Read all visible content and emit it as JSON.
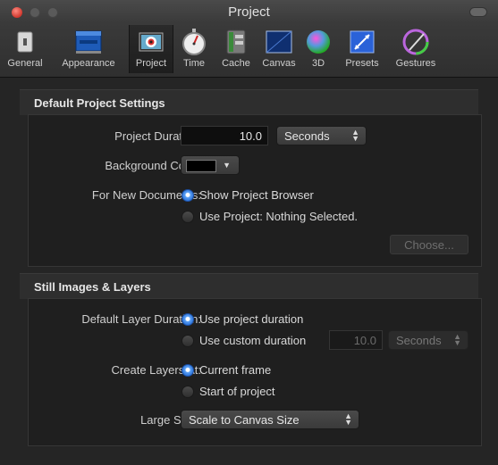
{
  "window": {
    "title": "Project"
  },
  "toolbar": {
    "items": [
      {
        "label": "General",
        "icon": "general-icon"
      },
      {
        "label": "Appearance",
        "icon": "appearance-icon"
      },
      {
        "label": "Project",
        "icon": "project-icon",
        "selected": true
      },
      {
        "label": "Time",
        "icon": "stopwatch-icon"
      },
      {
        "label": "Cache",
        "icon": "cache-icon"
      },
      {
        "label": "Canvas",
        "icon": "canvas-icon"
      },
      {
        "label": "3D",
        "icon": "sphere-3d-icon"
      },
      {
        "label": "Presets",
        "icon": "presets-icon"
      },
      {
        "label": "Gestures",
        "icon": "gestures-icon"
      }
    ]
  },
  "default_project": {
    "title": "Default Project Settings",
    "duration_label": "Project Duration:",
    "duration_value": "10.0",
    "duration_unit": "Seconds",
    "bg_color_label": "Background Color:",
    "bg_color": "#000000",
    "new_docs_label": "For New Documents:",
    "option_show_browser": "Show Project Browser",
    "option_use_project": "Use Project: Nothing Selected.",
    "choose_button": "Choose..."
  },
  "still_images": {
    "title": "Still Images & Layers",
    "layer_duration_label": "Default Layer Duration:",
    "option_project_duration": "Use project duration",
    "option_custom_duration": "Use custom duration",
    "custom_value": "10.0",
    "custom_unit": "Seconds",
    "create_at_label": "Create Layers At:",
    "option_current_frame": "Current frame",
    "option_start_project": "Start of project",
    "large_stills_label": "Large Stills:",
    "large_stills_value": "Scale to Canvas Size"
  },
  "colors": {
    "accent": "#2a6fd6",
    "background": "#252525"
  }
}
